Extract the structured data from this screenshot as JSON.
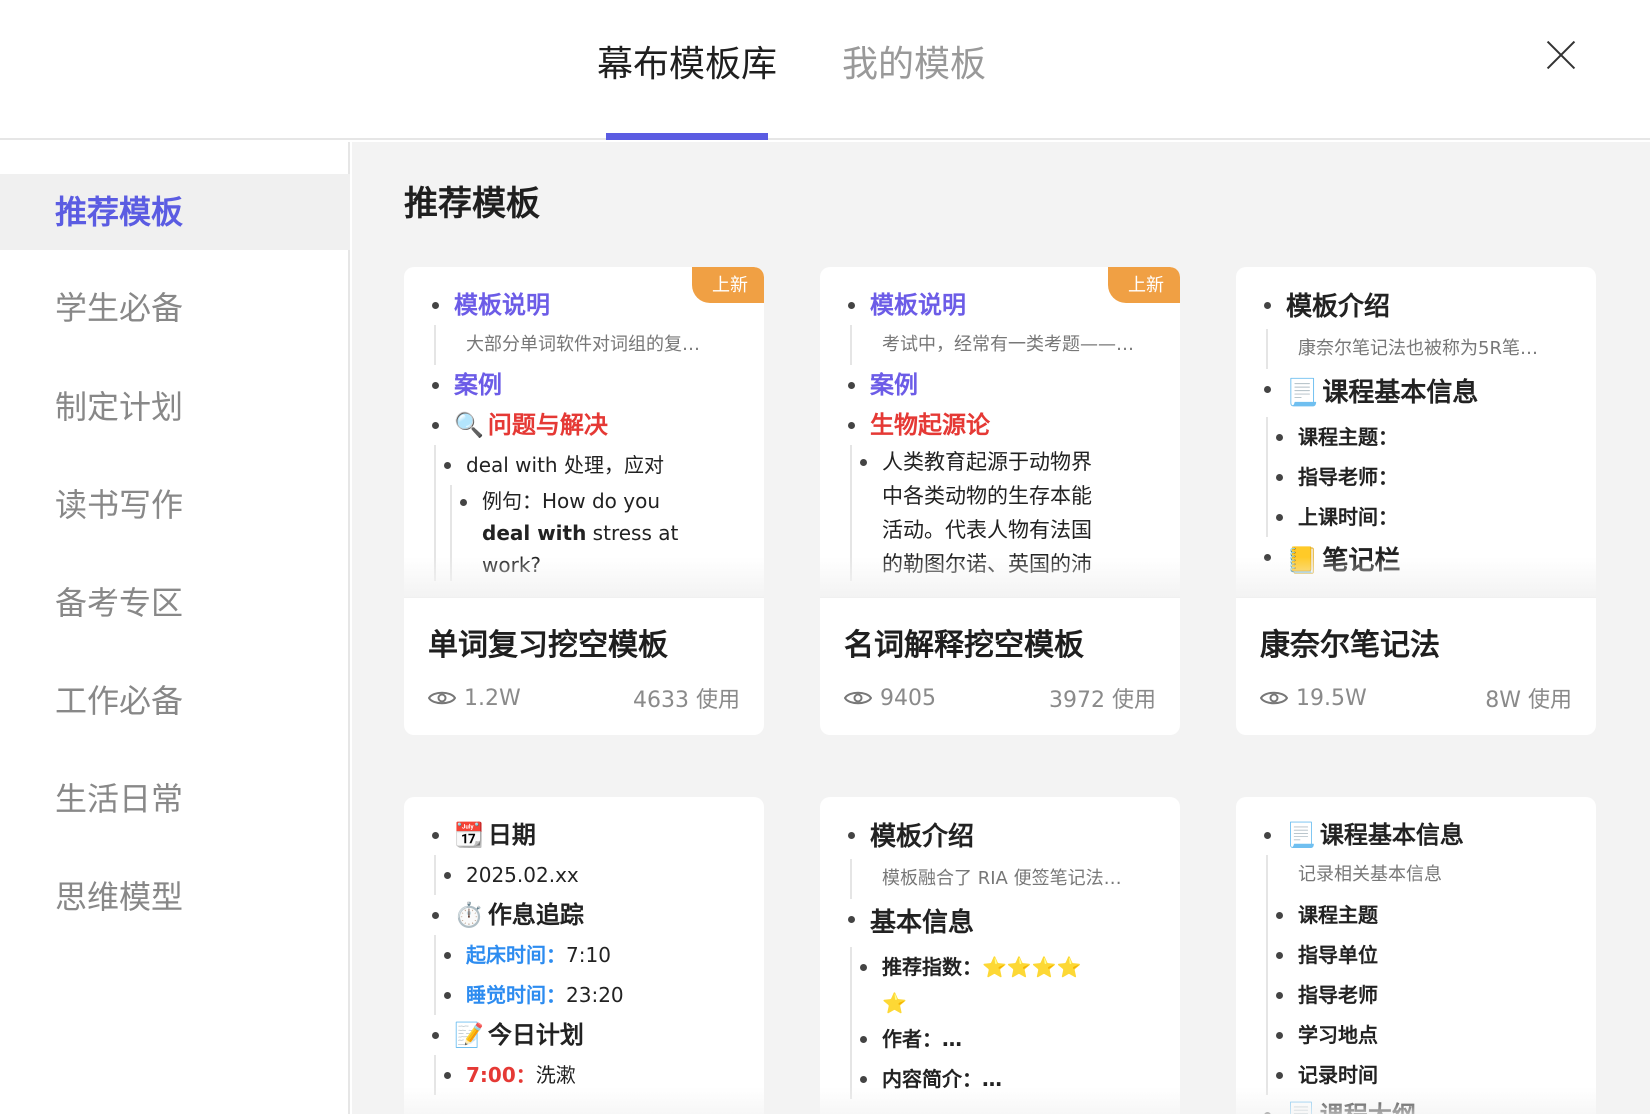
{
  "header": {
    "tabs": [
      {
        "label": "幕布模板库",
        "active": true
      },
      {
        "label": "我的模板",
        "active": false
      }
    ],
    "accent_color": "#5b5ce2"
  },
  "sidebar": {
    "items": [
      {
        "label": "推荐模板",
        "active": true
      },
      {
        "label": "学生必备"
      },
      {
        "label": "制定计划"
      },
      {
        "label": "读书写作"
      },
      {
        "label": "备考专区"
      },
      {
        "label": "工作必备"
      },
      {
        "label": "生活日常"
      },
      {
        "label": "思维模型"
      }
    ]
  },
  "main": {
    "title": "推荐模板",
    "cards": [
      {
        "title": "单词复习挖空模板",
        "views": "1.2W",
        "uses": "4633 使用",
        "badge": "上新",
        "preview": {
          "a": "模板说明",
          "a_note": "大部分单词软件对词组的复…",
          "b": "案例",
          "c_icon": "🔍",
          "c": "问题与解决",
          "d": "deal with  处理，应对",
          "e": "例句：How do you",
          "f_bold": "deal with",
          "f": " stress at",
          "g": "work?"
        }
      },
      {
        "title": "名词解释挖空模板",
        "views": "9405",
        "uses": "3972 使用",
        "badge": "上新",
        "preview": {
          "a": "模板说明",
          "a_note": "考试中，经常有一类考题——…",
          "b": "案例",
          "c": "生物起源论",
          "d1": "人类教育起源于动物界",
          "d2": "中各类动物的生存本能",
          "d3": "活动。代表人物有法国",
          "d4": "的勒图尔诺、英国的沛"
        }
      },
      {
        "title": "康奈尔笔记法",
        "views": "19.5W",
        "uses": "8W 使用",
        "preview": {
          "a": "模板介绍",
          "a_note": "康奈尔笔记法也被称为5R笔…",
          "b_icon": "📃",
          "b": "课程基本信息",
          "c1": "课程主题：",
          "c2": "指导老师：",
          "c3": "上课时间：",
          "d_icon": "📒",
          "d": "笔记栏"
        }
      },
      {
        "preview": {
          "a_icon": "📆",
          "a": "日期",
          "a1": "2025.02.xx",
          "b_icon": "⏱️",
          "b": "作息追踪",
          "b1_label": "起床时间：",
          "b1": "7:10",
          "b2_label": "睡觉时间：",
          "b2": "23:20",
          "c_icon": "📝",
          "c": "今日计划",
          "c1_label": "7:00：",
          "c1": "洗漱"
        }
      },
      {
        "preview": {
          "a": "模板介绍",
          "a_note": "模板融合了 RIA 便签笔记法…",
          "b": "基本信息",
          "b1_label": "推荐指数：",
          "b1": "⭐⭐⭐⭐",
          "b1_cont": "⭐",
          "b2": "作者：…",
          "b3": "内容简介：…"
        }
      },
      {
        "preview": {
          "a_icon": "📃",
          "a": "课程基本信息",
          "a_note": "记录相关基本信息",
          "items": [
            "课程主题",
            "指导单位",
            "指导老师",
            "学习地点",
            "记录时间"
          ],
          "b_icon": "📃",
          "b": "课程大纲"
        }
      }
    ]
  }
}
